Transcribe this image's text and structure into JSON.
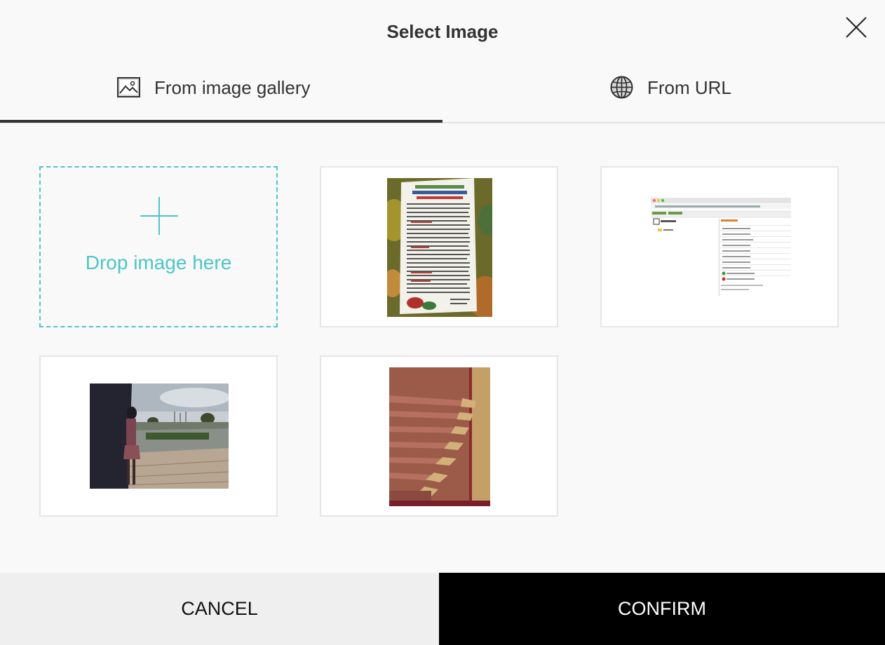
{
  "dialog": {
    "title": "Select Image",
    "close_icon": "close-icon"
  },
  "tabs": [
    {
      "label": "From image gallery",
      "icon": "image-icon",
      "active": true
    },
    {
      "label": "From URL",
      "icon": "globe-icon",
      "active": false
    }
  ],
  "gallery": {
    "drop_zone_label": "Drop image here",
    "drop_zone_icon": "plus-icon",
    "accent_color": "#4dc6c6",
    "images": [
      {
        "description": "photo of a printed church schedule flyer"
      },
      {
        "description": "screenshot of a file browser"
      },
      {
        "description": "photo of a woman leaning on a wall outdoors"
      },
      {
        "description": "photo of a folded copper silk saree"
      }
    ]
  },
  "footer": {
    "cancel_label": "CANCEL",
    "confirm_label": "CONFIRM"
  }
}
